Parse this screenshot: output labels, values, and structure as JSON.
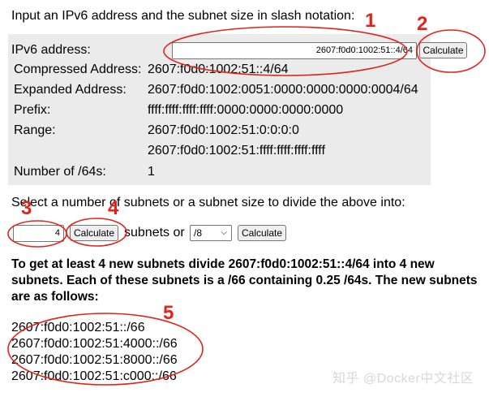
{
  "intro_text": "Input an IPv6 address and the subnet size in slash notation:",
  "ipv6_label": "IPv6 address:",
  "ipv6_value": "2607:f0d0:1002:51::4/64",
  "calculate_label": "Calculate",
  "info_rows": [
    {
      "label": "Compressed Address:",
      "value": "2607:f0d0:1002:51::4/64"
    },
    {
      "label": "Expanded Address:",
      "value": "2607:f0d0:1002:0051:0000:0000:0000:0004/64"
    },
    {
      "label": "Prefix:",
      "value": "ffff:ffff:ffff:ffff:0000:0000:0000:0000"
    },
    {
      "label": "Range:",
      "value": "2607:f0d0:1002:51:0:0:0:0"
    },
    {
      "label": "",
      "value": "2607:f0d0:1002:51:ffff:ffff:ffff:ffff"
    },
    {
      "label": "Number of /64s:",
      "value": "1"
    }
  ],
  "divide_text": "Select a number of subnets or a subnet size to divide the above into:",
  "subnet_count_value": "4",
  "subnets_or_text": "subnets or",
  "size_select_value": "/8",
  "result_text": "To get at least 4 new subnets divide 2607:f0d0:1002:51::4/64 into 4 new subnets. Each of these subnets is a /66 containing 0.25 /64s. The new subnets are as follows:",
  "subnets": [
    "2607:f0d0:1002:51::/66",
    "2607:f0d0:1002:51:4000::/66",
    "2607:f0d0:1002:51:8000::/66",
    "2607:f0d0:1002:51:c000::/66"
  ],
  "annotations": [
    "1",
    "2",
    "3",
    "4",
    "5"
  ],
  "annotation_color": "#e0231b",
  "watermark": "知乎 @Docker中文社区"
}
